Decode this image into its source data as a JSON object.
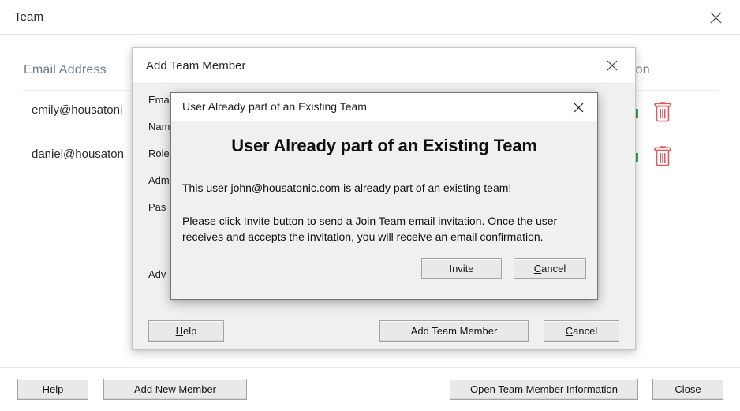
{
  "main_window": {
    "title": "Team",
    "close_icon": "close-icon",
    "table": {
      "columns": [
        "Email Address",
        "ction"
      ],
      "rows": [
        {
          "email": "emily@housatoni",
          "status": "active",
          "delete_icon": "trash-icon"
        },
        {
          "email": "daniel@housaton",
          "status": "active",
          "delete_icon": "trash-icon"
        }
      ]
    },
    "bottom_bar": {
      "help_label": "Help",
      "help_accel": "H",
      "add_new_member_label": "Add New Member",
      "open_team_info_label": "Open Team Member Information",
      "close_label": "Close",
      "close_accel": "C"
    }
  },
  "add_member_dialog": {
    "title": "Add Team Member",
    "close_icon": "close-icon",
    "form_labels": [
      "Ema",
      "Nam",
      "Role",
      "Adm",
      "Pas",
      "Adv"
    ],
    "buttons": {
      "help_label": "Help",
      "help_accel": "H",
      "add_team_member_label": "Add Team Member",
      "cancel_label": "Cancel",
      "cancel_accel": "C"
    }
  },
  "alert_dialog": {
    "title": "User Already part of an Existing Team",
    "close_icon": "close-icon",
    "heading": "User Already part of an Existing Team",
    "message_primary": "This user john@housatonic.com is already part of an existing team!",
    "message_secondary": "Please click Invite button to send a Join Team email invitation. Once the user receives and accepts the invitation, you will receive an email confirmation.",
    "buttons": {
      "invite_label": "Invite",
      "cancel_label": "Cancel",
      "cancel_accel": "C"
    }
  },
  "colors": {
    "accent_delete": "#e05a5a",
    "status_active": "#3fa34d",
    "header_text": "#6e7a8a",
    "dialog_bg": "#f0f0f0"
  }
}
